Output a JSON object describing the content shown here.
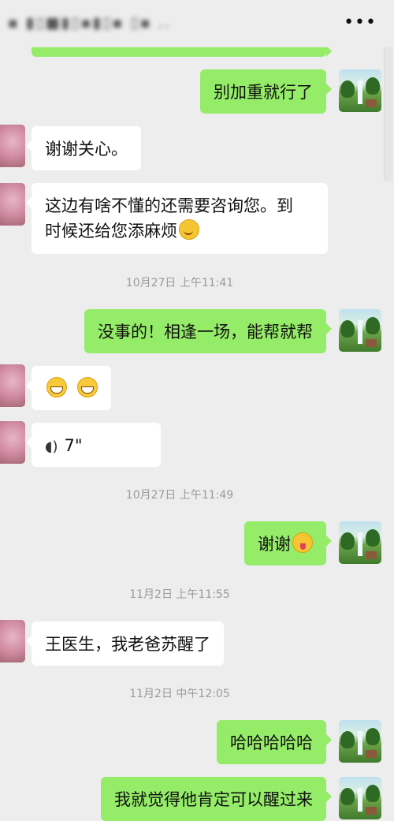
{
  "header": {
    "title": "▪ ▮▯■▮▯▪▮▯▪ ▯▪ ..",
    "more_icon": "•••"
  },
  "messages": [
    {
      "dir": "out",
      "text": "别加重就行了"
    },
    {
      "dir": "in",
      "text": "谢谢关心。"
    },
    {
      "dir": "in",
      "line1": "这边有啥不懂的还需要咨询您。到",
      "line2": "时候还给您添麻烦"
    },
    {
      "dir": "ts",
      "text": "10月27日 上午11:41"
    },
    {
      "dir": "out",
      "text": "没事的！相逢一场，能帮就帮"
    },
    {
      "dir": "in",
      "text": ""
    },
    {
      "dir": "in",
      "voice": "7\""
    },
    {
      "dir": "ts",
      "text": "10月27日 上午11:49"
    },
    {
      "dir": "out",
      "text": "谢谢"
    },
    {
      "dir": "ts",
      "text": "11月2日 上午11:55"
    },
    {
      "dir": "in",
      "text": "王医生，我老爸苏醒了"
    },
    {
      "dir": "ts",
      "text": "11月2日 中午12:05"
    },
    {
      "dir": "out",
      "text": "哈哈哈哈哈"
    },
    {
      "dir": "out",
      "text": "我就觉得他肯定可以醒过来"
    }
  ],
  "colors": {
    "out_bubble": "#95ec69",
    "in_bubble": "#ffffff",
    "background": "#ededed"
  },
  "icons": {
    "avatar_me": "landscape-painting-avatar",
    "avatar_other": "flower-avatar",
    "emoji_smile": "smile-emoji",
    "emoji_grin": "grin-emoji",
    "emoji_wink": "wink-tongue-emoji",
    "voice": "voice-wave-icon"
  }
}
